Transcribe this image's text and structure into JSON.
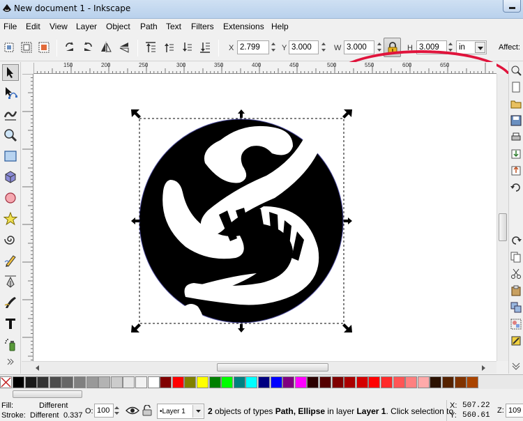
{
  "window": {
    "title": "New document 1 - Inkscape"
  },
  "menu": [
    "File",
    "Edit",
    "View",
    "Layer",
    "Object",
    "Path",
    "Text",
    "Filters",
    "Extensions",
    "Help"
  ],
  "toolbar": {
    "x_label": "X",
    "x_value": "2.799",
    "y_label": "Y",
    "y_value": "3.000",
    "w_label": "W",
    "w_value": "3.000",
    "h_label": "H",
    "h_value": "3.009",
    "units": "in",
    "affect_label": "Affect:"
  },
  "ruler": {
    "h_labels": [
      "150",
      "200",
      "250",
      "300",
      "350",
      "400",
      "450",
      "500",
      "550",
      "600",
      "650"
    ]
  },
  "palette": {
    "colors": [
      "#000000",
      "#1a1a1a",
      "#333333",
      "#4d4d4d",
      "#666666",
      "#808080",
      "#999999",
      "#b3b3b3",
      "#cccccc",
      "#e6e6e6",
      "#f2f2f2",
      "#ffffff",
      "#800000",
      "#ff0000",
      "#808000",
      "#ffff00",
      "#008000",
      "#00ff00",
      "#008080",
      "#00ffff",
      "#000080",
      "#0000ff",
      "#800080",
      "#ff00ff",
      "#2b0000",
      "#550000",
      "#800000",
      "#aa0000",
      "#d40000",
      "#ff0000",
      "#ff2a2a",
      "#ff5555",
      "#ff8080",
      "#ffaaaa",
      "#2b1100",
      "#552200",
      "#803300",
      "#aa4400"
    ]
  },
  "status": {
    "fill_label": "Fill:",
    "fill_value": "Different",
    "stroke_label": "Stroke:",
    "stroke_value": "Different",
    "stroke_width": "0.337",
    "opacity_label": "O:",
    "opacity_value": "100",
    "layer": "•Layer 1",
    "message_count": "2",
    "message_a": " objects of types ",
    "message_types": "Path, Ellipse",
    "message_b": " in layer ",
    "message_layer": "Layer 1",
    "message_c": ". Click selection to",
    "x_label": "X:",
    "x_value": "507.22",
    "y_label": "Y:",
    "y_value": "560.61",
    "zoom_label": "Z:",
    "zoom_value": "109"
  }
}
